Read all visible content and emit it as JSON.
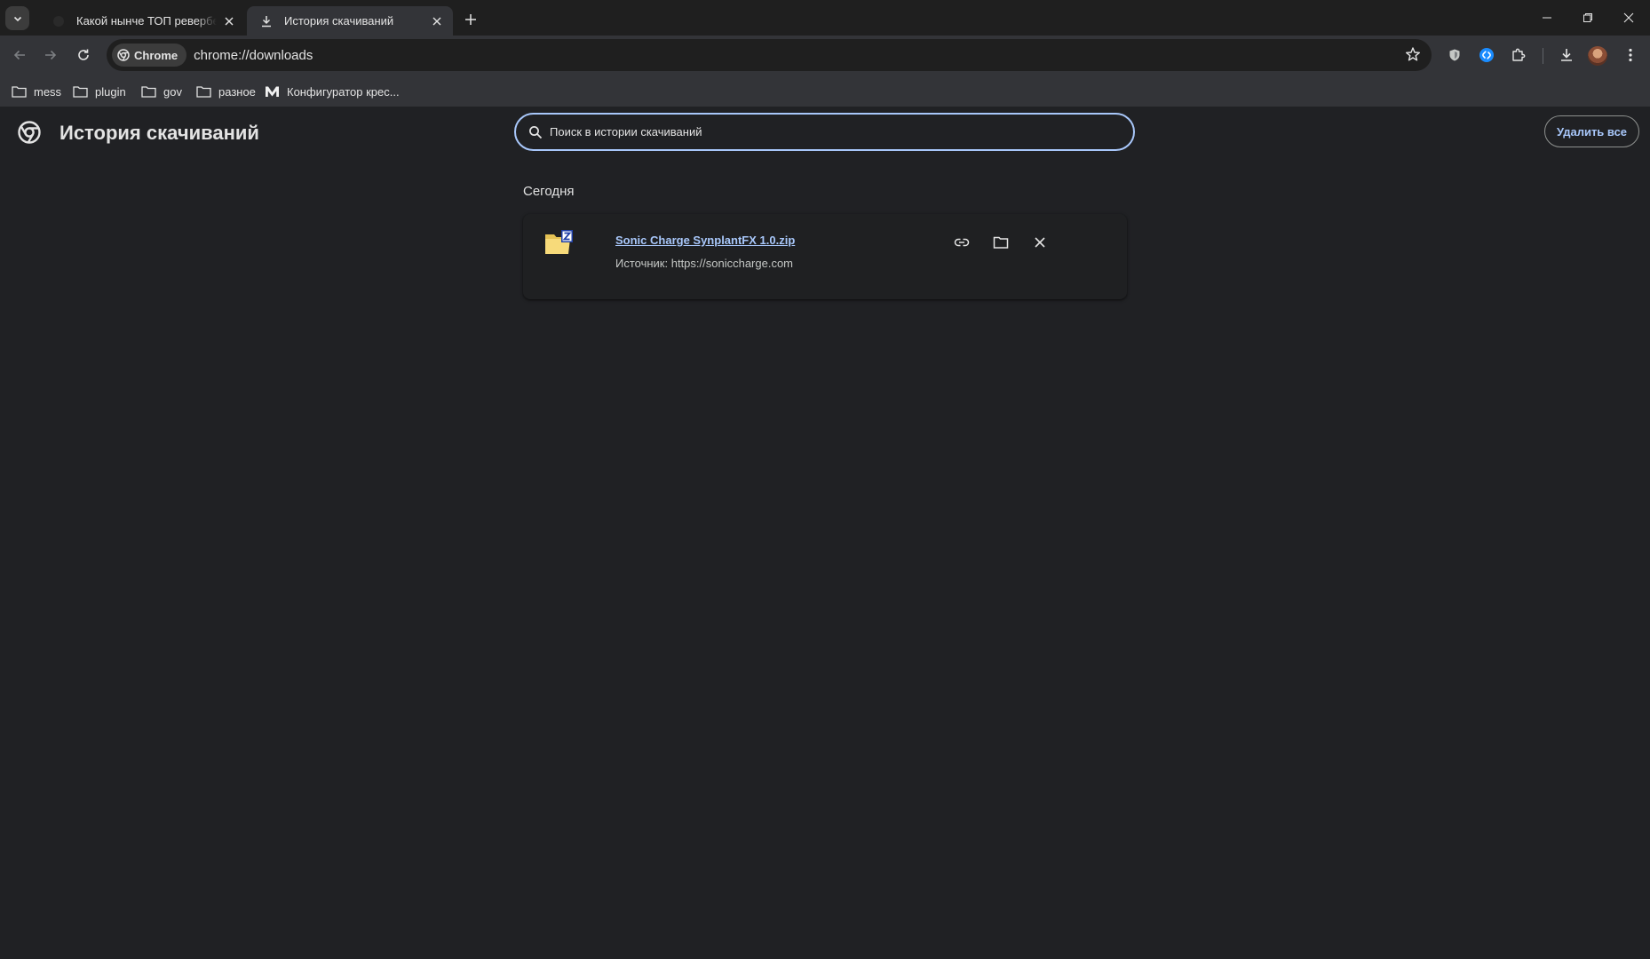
{
  "tabs": [
    {
      "title": "Какой нынче ТОП ревербератор",
      "active": false
    },
    {
      "title": "История скачиваний",
      "active": true
    }
  ],
  "toolbar": {
    "chip_label": "Chrome",
    "url": "chrome://downloads"
  },
  "bookmarks": [
    {
      "label": "mess",
      "icon": "folder-icon"
    },
    {
      "label": "plugin",
      "icon": "folder-icon"
    },
    {
      "label": "gov",
      "icon": "folder-icon"
    },
    {
      "label": "разное",
      "icon": "folder-icon"
    },
    {
      "label": "Конфигуратор крес...",
      "icon": "m-logo-icon"
    }
  ],
  "page": {
    "title": "История скачиваний",
    "search_placeholder": "Поиск в истории скачиваний",
    "clear_all_label": "Удалить все",
    "section_label": "Сегодня"
  },
  "downloads": [
    {
      "file_name": "Sonic Charge SynplantFX 1.0.zip",
      "source_label": "Источник: https://soniccharge.com",
      "icon": "zip-archive-icon"
    }
  ],
  "colors": {
    "accent": "#a8c7fa",
    "background": "#202124",
    "toolbar": "#333438"
  }
}
